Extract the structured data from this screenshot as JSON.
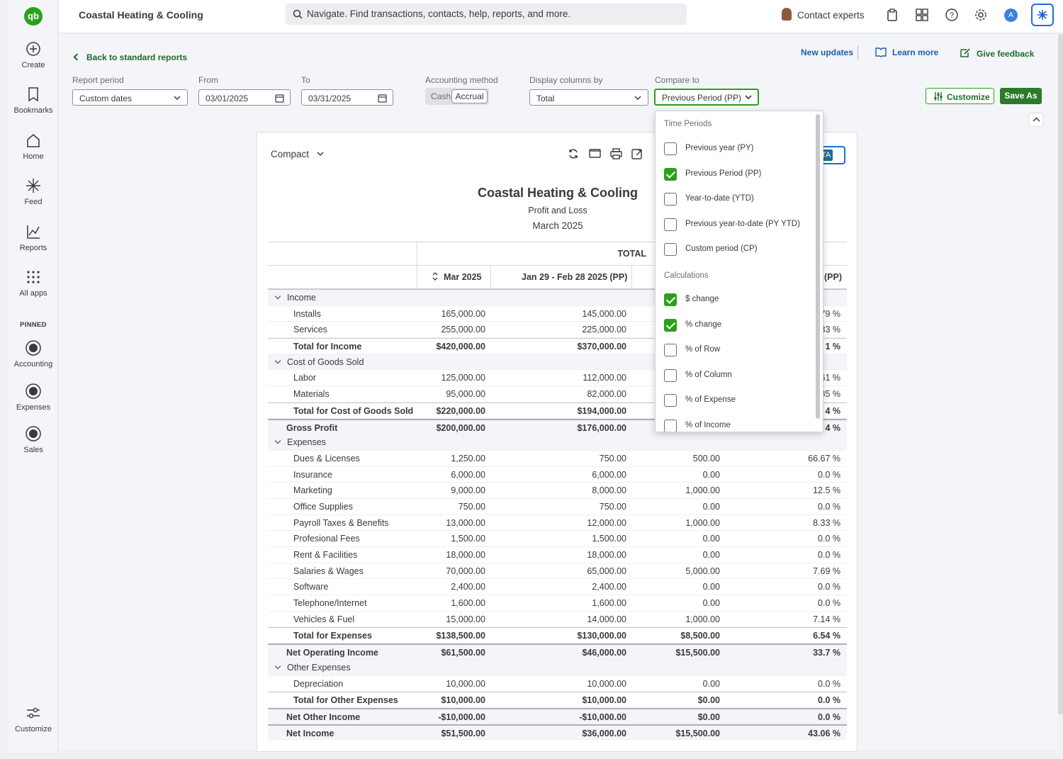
{
  "app": {
    "logo": "qb",
    "company": "Coastal Heating & Cooling"
  },
  "search": {
    "placeholder": "Navigate. Find transactions, contacts, help, reports, and more."
  },
  "topbar": {
    "contact_experts": "Contact experts",
    "avatar": "A"
  },
  "sidebar": {
    "items": [
      {
        "label": "Create",
        "icon": "plus-circle-icon"
      },
      {
        "label": "Bookmarks",
        "icon": "bookmark-icon"
      },
      {
        "label": "Home",
        "icon": "home-icon"
      },
      {
        "label": "Feed",
        "icon": "sparkle-icon"
      },
      {
        "label": "Reports",
        "icon": "chart-icon"
      },
      {
        "label": "All apps",
        "icon": "grid-icon"
      }
    ],
    "pinned_label": "PINNED",
    "pinned": [
      {
        "label": "Accounting",
        "icon": "accounting-icon"
      },
      {
        "label": "Expenses",
        "icon": "expenses-icon"
      },
      {
        "label": "Sales",
        "icon": "sales-icon"
      }
    ],
    "customize": "Customize"
  },
  "header": {
    "back": "Back to standard reports",
    "new_updates": "New updates",
    "learn_more": "Learn more",
    "give_feedback": "Give feedback"
  },
  "filters": {
    "report_period_label": "Report period",
    "report_period_value": "Custom dates",
    "from_label": "From",
    "from_value": "03/01/2025",
    "to_label": "To",
    "to_value": "03/31/2025",
    "accounting_label": "Accounting method",
    "cash": "Cash",
    "accrual": "Accrual",
    "display_label": "Display columns by",
    "display_value": "Total",
    "compare_label": "Compare to",
    "compare_value": "Previous Period (PP)",
    "customize": "Customize",
    "save_as": "Save As"
  },
  "report": {
    "view": "Compact",
    "badge": "TA",
    "title": "Coastal Heating & Cooling",
    "subtitle": "Profit and Loss",
    "date": "March 2025",
    "total_header": "TOTAL",
    "col1": "Mar 2025",
    "col2": "Jan 29 - Feb 28 2025 (PP)",
    "col4": "(PP)",
    "rows": [
      {
        "type": "grp",
        "label": "Income",
        "v": [
          "",
          "",
          "",
          ""
        ]
      },
      {
        "type": "item",
        "label": "Installs",
        "v": [
          "165,000.00",
          "145,000.00",
          "",
          "79 %"
        ]
      },
      {
        "type": "item",
        "label": "Services",
        "v": [
          "255,000.00",
          "225,000.00",
          "",
          "33 %"
        ]
      },
      {
        "type": "tot",
        "label": "Total for Income",
        "v": [
          "$420,000.00",
          "$370,000.00",
          "",
          "1 %"
        ]
      },
      {
        "type": "grp",
        "label": "Cost of Goods Sold",
        "v": [
          "",
          "",
          "",
          ""
        ]
      },
      {
        "type": "item",
        "label": "Labor",
        "v": [
          "125,000.00",
          "112,000.00",
          "",
          "61 %"
        ]
      },
      {
        "type": "item",
        "label": "Materials",
        "v": [
          "95,000.00",
          "82,000.00",
          "",
          "85 %"
        ]
      },
      {
        "type": "tot",
        "label": "Total for Cost of Goods Sold",
        "v": [
          "$220,000.00",
          "$194,000.00",
          "",
          "4 %"
        ]
      },
      {
        "type": "sub",
        "label": "Gross Profit",
        "v": [
          "$200,000.00",
          "$176,000.00",
          "",
          "4 %"
        ]
      },
      {
        "type": "grp",
        "label": "Expenses",
        "v": [
          "",
          "",
          "",
          ""
        ]
      },
      {
        "type": "item",
        "label": "Dues & Licenses",
        "v": [
          "1,250.00",
          "750.00",
          "500.00",
          "66.67 %"
        ]
      },
      {
        "type": "item",
        "label": "Insurance",
        "v": [
          "6,000.00",
          "6,000.00",
          "0.00",
          "0.0 %"
        ]
      },
      {
        "type": "item",
        "label": "Marketing",
        "v": [
          "9,000.00",
          "8,000.00",
          "1,000.00",
          "12.5 %"
        ]
      },
      {
        "type": "item",
        "label": "Office Supplies",
        "v": [
          "750.00",
          "750.00",
          "0.00",
          "0.0 %"
        ]
      },
      {
        "type": "item",
        "label": "Payroll Taxes & Benefits",
        "v": [
          "13,000.00",
          "12,000.00",
          "1,000.00",
          "8.33 %"
        ]
      },
      {
        "type": "item",
        "label": "Profesional Fees",
        "v": [
          "1,500.00",
          "1,500.00",
          "0.00",
          "0.0 %"
        ]
      },
      {
        "type": "item",
        "label": "Rent & Facilities",
        "v": [
          "18,000.00",
          "18,000.00",
          "0.00",
          "0.0 %"
        ]
      },
      {
        "type": "item",
        "label": "Salaries & Wages",
        "v": [
          "70,000.00",
          "65,000.00",
          "5,000.00",
          "7.69 %"
        ]
      },
      {
        "type": "item",
        "label": "Software",
        "v": [
          "2,400.00",
          "2,400.00",
          "0.00",
          "0.0 %"
        ]
      },
      {
        "type": "item",
        "label": "Telephone/Internet",
        "v": [
          "1,600.00",
          "1,600.00",
          "0.00",
          "0.0 %"
        ]
      },
      {
        "type": "item",
        "label": "Vehicles & Fuel",
        "v": [
          "15,000.00",
          "14,000.00",
          "1,000.00",
          "7.14 %"
        ]
      },
      {
        "type": "tot",
        "label": "Total for Expenses",
        "v": [
          "$138,500.00",
          "$130,000.00",
          "$8,500.00",
          "6.54 %"
        ]
      },
      {
        "type": "sub",
        "label": "Net Operating Income",
        "v": [
          "$61,500.00",
          "$46,000.00",
          "$15,500.00",
          "33.7 %"
        ]
      },
      {
        "type": "grp",
        "label": "Other Expenses",
        "v": [
          "",
          "",
          "",
          ""
        ]
      },
      {
        "type": "item",
        "label": "Depreciation",
        "v": [
          "10,000.00",
          "10,000.00",
          "0.00",
          "0.0 %"
        ]
      },
      {
        "type": "tot",
        "label": "Total for Other Expenses",
        "v": [
          "$10,000.00",
          "$10,000.00",
          "$0.00",
          "0.0 %"
        ]
      },
      {
        "type": "sub",
        "label": "Net Other Income",
        "v": [
          "-$10,000.00",
          "-$10,000.00",
          "$0.00",
          "0.0 %"
        ]
      },
      {
        "type": "sub",
        "label": "Net Income",
        "v": [
          "$51,500.00",
          "$36,000.00",
          "$15,500.00",
          "43.06 %"
        ]
      }
    ]
  },
  "compare_menu": {
    "time_periods_label": "Time Periods",
    "time_periods": [
      {
        "label": "Previous year (PY)",
        "checked": false
      },
      {
        "label": "Previous Period (PP)",
        "checked": true
      },
      {
        "label": "Year-to-date (YTD)",
        "checked": false
      },
      {
        "label": "Previous year-to-date (PY YTD)",
        "checked": false
      },
      {
        "label": "Custom period (CP)",
        "checked": false
      }
    ],
    "calculations_label": "Calculations",
    "calculations": [
      {
        "label": "$ change",
        "checked": true
      },
      {
        "label": "% change",
        "checked": true
      },
      {
        "label": "% of Row",
        "checked": false
      },
      {
        "label": "% of Column",
        "checked": false
      },
      {
        "label": "% of Expense",
        "checked": false
      },
      {
        "label": "% of Income",
        "checked": false
      }
    ]
  }
}
